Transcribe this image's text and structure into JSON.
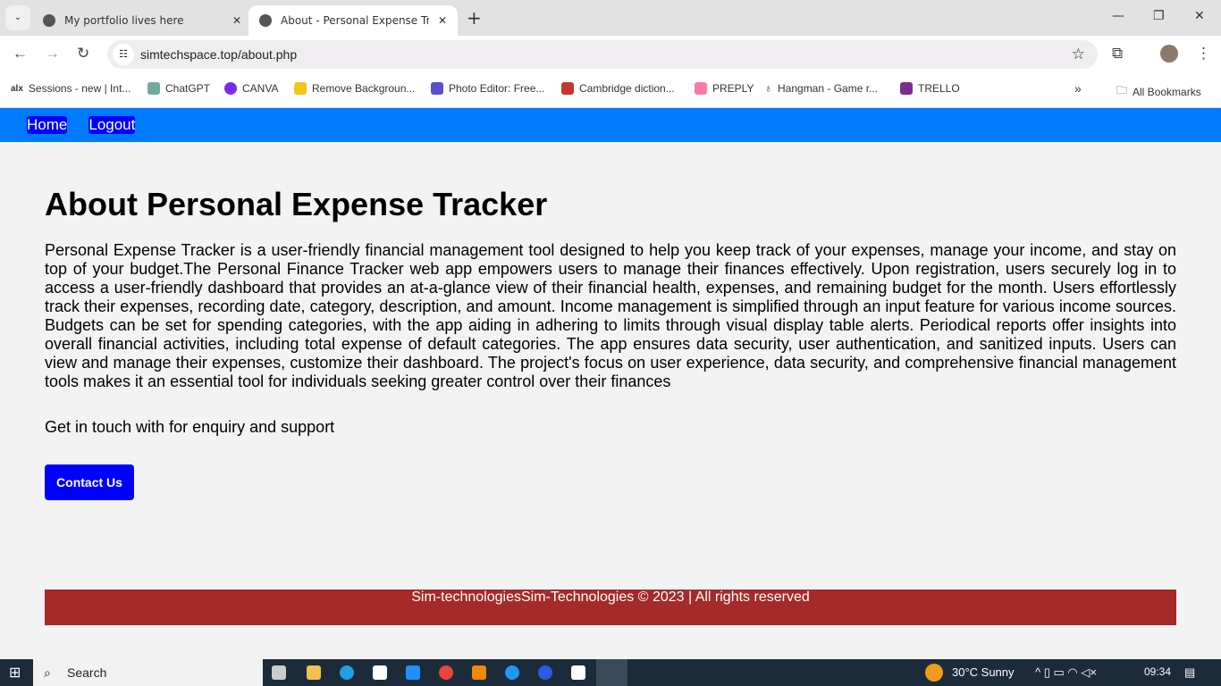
{
  "browser": {
    "tabs": [
      {
        "title": "My portfolio lives here",
        "active": false
      },
      {
        "title": "About - Personal Expense Tracker",
        "active": true
      }
    ],
    "url": "simtechspace.top/about.php",
    "bookmarks": [
      {
        "label": "Sessions - new | Int...",
        "color": "#222222"
      },
      {
        "label": "ChatGPT",
        "color": "#74aa9c"
      },
      {
        "label": "CANVA",
        "color": "#7d2ae8"
      },
      {
        "label": "Remove Backgroun...",
        "color": "#f5c518"
      },
      {
        "label": "Photo Editor: Free...",
        "color": "#5b4fc9"
      },
      {
        "label": "Cambridge diction...",
        "color": "#c0392b"
      },
      {
        "label": "PREPLY",
        "color": "#ff7aac"
      },
      {
        "label": "Hangman - Game r...",
        "color": "#ffffff"
      },
      {
        "label": "TRELLO",
        "color": "#7b2d8e"
      }
    ],
    "all_bookmarks": "All Bookmarks"
  },
  "nav": {
    "home": "Home",
    "logout": "Logout",
    "bg": "#007bff"
  },
  "page": {
    "title": "About Personal Expense Tracker",
    "description": "Personal Expense Tracker is a user-friendly financial management tool designed to help you keep track of your expenses, manage your income, and stay on top of your budget.The Personal Finance Tracker web app empowers users to manage their finances effectively. Upon registration, users securely log in to access a user-friendly dashboard that provides an at-a-glance view of their financial health, expenses, and remaining budget for the month. Users effortlessly track their expenses, recording date, category, description, and amount. Income management is simplified through an input feature for various income sources. Budgets can be set for spending categories, with the app aiding in adhering to limits through visual display table alerts. Periodical reports offer insights into overall financial activities, including total expense of default categories. The app ensures data security, user authentication, and sanitized inputs. Users can view and manage their expenses, customize their dashboard. The project's focus on user experience, data security, and comprehensive financial management tools makes it an essential tool for individuals seeking greater control over their finances",
    "touch": "Get in touch with for enquiry and support",
    "contact_button": "Contact Us",
    "footer": "Sim-technologiesSim-Technologies © 2023 | All rights reserved"
  },
  "taskbar": {
    "search": "Search",
    "weather": "30°C  Sunny",
    "time": "09:34"
  }
}
